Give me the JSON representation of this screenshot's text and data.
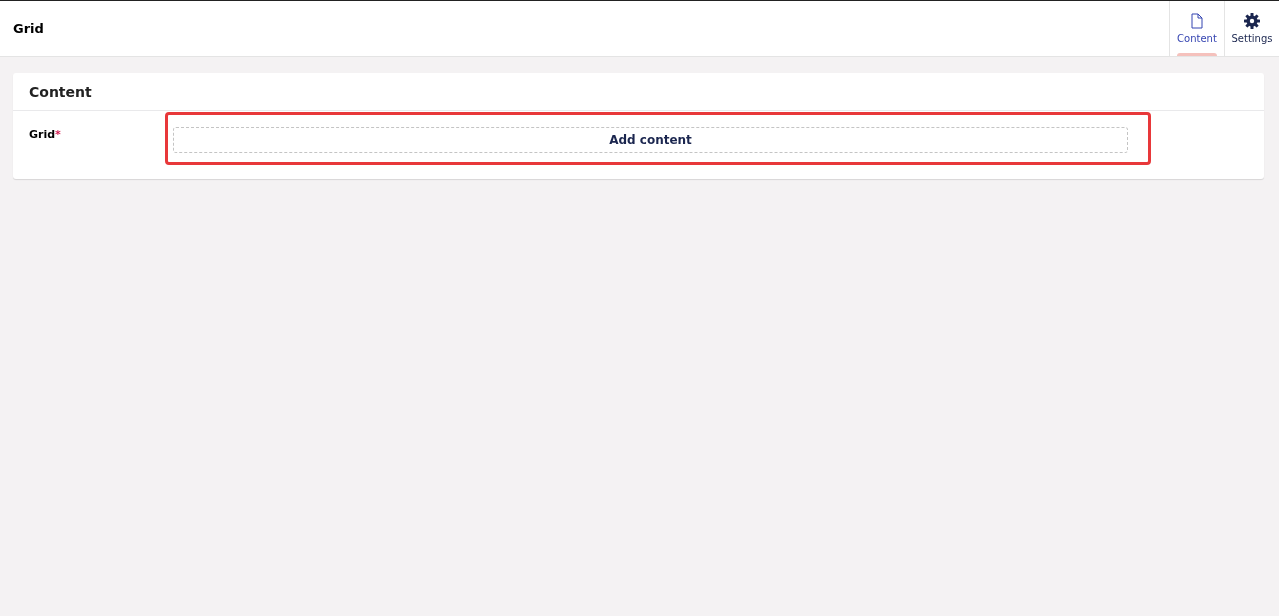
{
  "header": {
    "title": "Grid"
  },
  "tabs": [
    {
      "label": "Content",
      "kind": "document",
      "selected": true
    },
    {
      "label": "Settings",
      "kind": "gear",
      "selected": false
    }
  ],
  "panel": {
    "title": "Content",
    "properties": [
      {
        "label": "Grid",
        "required_mark": "*",
        "highlighted": true,
        "button": "Add content"
      }
    ]
  }
}
